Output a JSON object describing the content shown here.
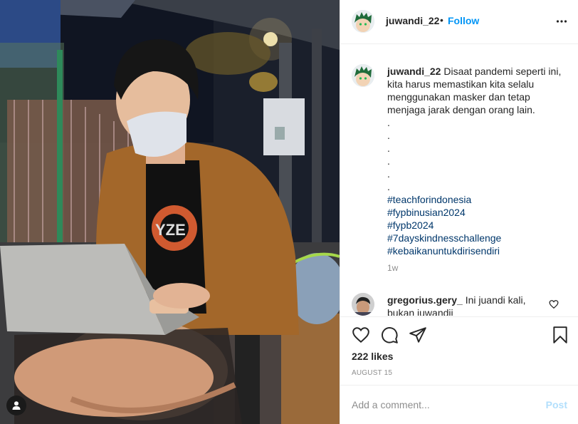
{
  "post": {
    "author": {
      "username": "juwandi_22",
      "separator": "•",
      "follow_label": "Follow",
      "avatar_icon": "green-haired-cartoon-avatar"
    },
    "more_icon": "more-options-icon",
    "caption": {
      "username": "juwandi_22",
      "text": "Disaat pandemi seperti ini, kita harus memastikan kita selalu menggunakan masker dan tetap menjaga jarak dengan orang lain.",
      "dots": [
        ".",
        ".",
        ".",
        ".",
        ".",
        "."
      ],
      "hashtags": [
        "#teachforindonesia",
        "#fypbinusian2024",
        "#fypb2024",
        "#7dayskindnesschallenge",
        "#kebaikanuntukdirisendiri"
      ],
      "time": "1w"
    },
    "comments": [
      {
        "username": "gregorius.gery_",
        "text": "Ini juandi kali, bukan juwandii"
      }
    ],
    "actions": {
      "like_icon": "heart-icon",
      "comment_icon": "comment-icon",
      "share_icon": "share-icon",
      "save_icon": "bookmark-icon"
    },
    "likes": "222 likes",
    "date": "AUGUST 15",
    "add_comment": {
      "placeholder": "Add a comment...",
      "post_label": "Post"
    },
    "photo": {
      "description_icon": "tagged-user-icon"
    },
    "colors": {
      "link_blue": "#0095f6",
      "hashtag_blue": "#00376b",
      "muted": "#8e8e8e",
      "post_disabled": "#b2dffc"
    }
  }
}
